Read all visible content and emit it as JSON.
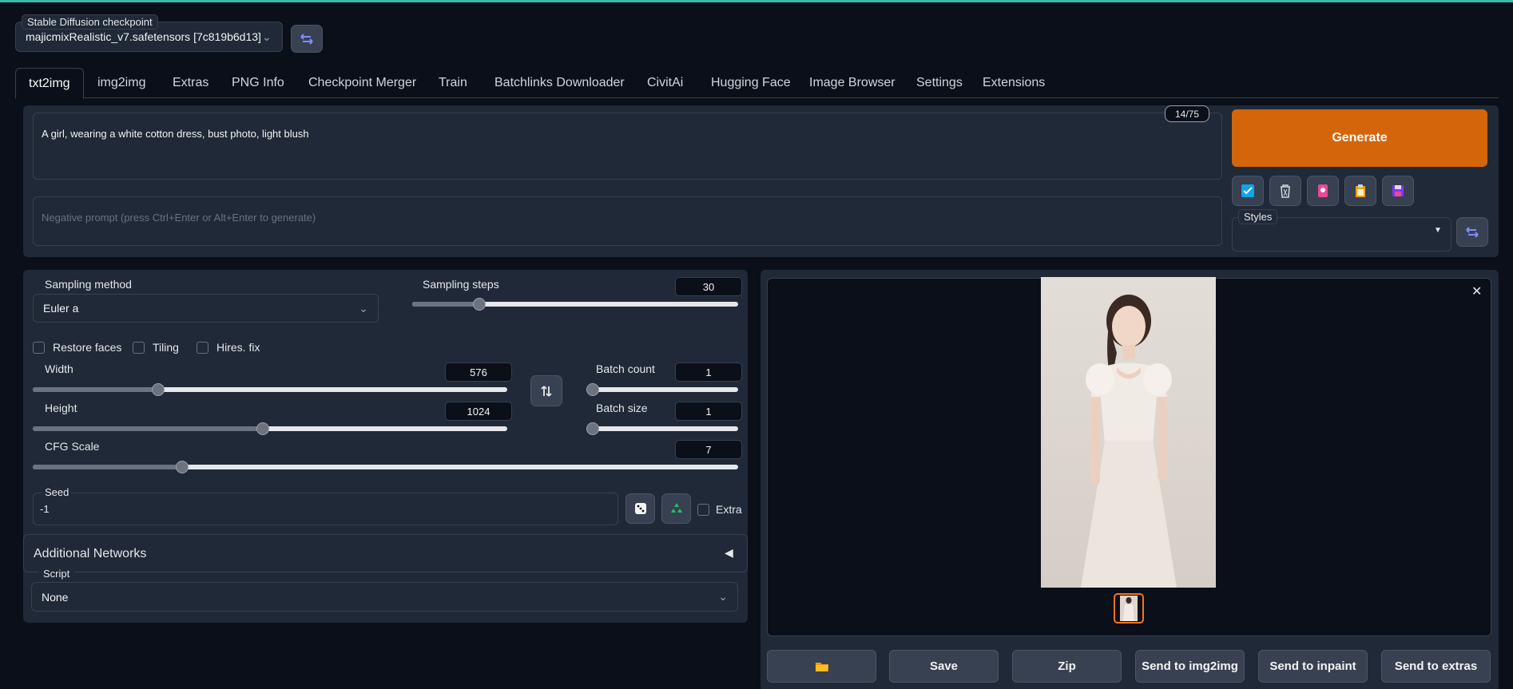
{
  "checkpoint": {
    "label": "Stable Diffusion checkpoint",
    "value": "majicmixRealistic_v7.safetensors [7c819b6d13]"
  },
  "tabs": [
    "txt2img",
    "img2img",
    "Extras",
    "PNG Info",
    "Checkpoint Merger",
    "Train",
    "Batchlinks Downloader",
    "CivitAi",
    "Hugging Face",
    "Image Browser",
    "Settings",
    "Extensions"
  ],
  "prompt": {
    "value": "A girl, wearing a white cotton dress, bust photo, light blush",
    "token_count": "14/75"
  },
  "negative_prompt": {
    "placeholder": "Negative prompt (press Ctrl+Enter or Alt+Enter to generate)"
  },
  "generate_label": "Generate",
  "styles_label": "Styles",
  "sampling_method": {
    "label": "Sampling method",
    "value": "Euler a"
  },
  "sampling_steps": {
    "label": "Sampling steps",
    "value": "30",
    "min": 1,
    "max": 150
  },
  "options": {
    "restore_faces": "Restore faces",
    "tiling": "Tiling",
    "hires_fix": "Hires. fix"
  },
  "width": {
    "label": "Width",
    "value": "576",
    "min": 64,
    "max": 2048
  },
  "height": {
    "label": "Height",
    "value": "1024",
    "min": 64,
    "max": 2048
  },
  "batch_count": {
    "label": "Batch count",
    "value": "1",
    "min": 1,
    "max": 100
  },
  "batch_size": {
    "label": "Batch size",
    "value": "1",
    "min": 1,
    "max": 8
  },
  "cfg_scale": {
    "label": "CFG Scale",
    "value": "7",
    "min": 1,
    "max": 30
  },
  "seed": {
    "label": "Seed",
    "value": "-1",
    "extra": "Extra"
  },
  "additional_networks": "Additional Networks",
  "script": {
    "label": "Script",
    "value": "None"
  },
  "actions": [
    "Save",
    "Zip",
    "Send to img2img",
    "Send to inpaint",
    "Send to extras"
  ],
  "icons": {
    "folder": "folder-icon",
    "dice": "dice-icon",
    "recycle": "recycle-icon"
  },
  "colors": {
    "accent": "#d4650b",
    "background": "#0b0f19",
    "panel": "#1f2937"
  }
}
